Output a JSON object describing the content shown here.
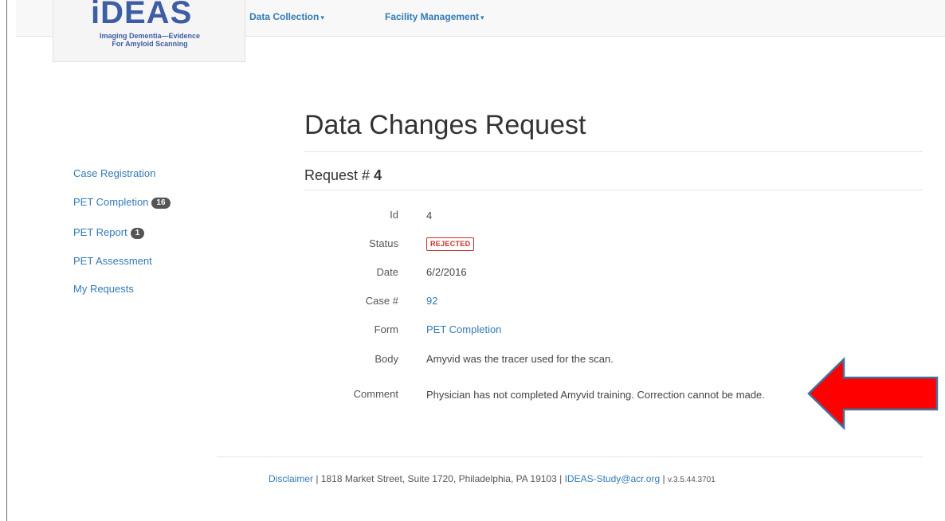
{
  "brand": {
    "logo_text": "iDEAS",
    "tagline_line1": "Imaging Dementia—Evidence",
    "tagline_line2": "For Amyloid Scanning"
  },
  "nav": {
    "menus": [
      {
        "label": "Data Collection"
      },
      {
        "label": "Facility Management"
      }
    ]
  },
  "sidebar": {
    "items": [
      {
        "label": "Case Registration"
      },
      {
        "label": "PET Completion",
        "badge": "16"
      },
      {
        "label": "PET Report",
        "badge": "1"
      },
      {
        "label": "PET Assessment"
      },
      {
        "label": "My Requests"
      }
    ]
  },
  "page": {
    "title": "Data Changes Request",
    "request_prefix": "Request #",
    "request_number": "4"
  },
  "details": {
    "id_label": "Id",
    "id_value": "4",
    "status_label": "Status",
    "status_value": "REJECTED",
    "date_label": "Date",
    "date_value": "6/2/2016",
    "case_label": "Case #",
    "case_value": "92",
    "form_label": "Form",
    "form_value": "PET Completion",
    "body_label": "Body",
    "body_value": "Amyvid was the tracer used for the scan.",
    "comment_label": "Comment",
    "comment_value": "Physician has not completed Amyvid training. Correction cannot be made."
  },
  "footer": {
    "disclaimer": "Disclaimer",
    "address": " | 1818 Market Street, Suite 1720, Philadelphia, PA 19103 | ",
    "email": "IDEAS-Study@acr.org",
    "separator": " | ",
    "version": "v.3.5.44.3701"
  },
  "colors": {
    "link": "#337ab7",
    "brand": "#3d5da5",
    "status_rejected": "#c9302c",
    "arrow_fill": "#ff0000",
    "arrow_stroke": "#41719c"
  },
  "icons": {
    "arrow": "left-arrow-icon",
    "caret": "caret-down-icon"
  }
}
